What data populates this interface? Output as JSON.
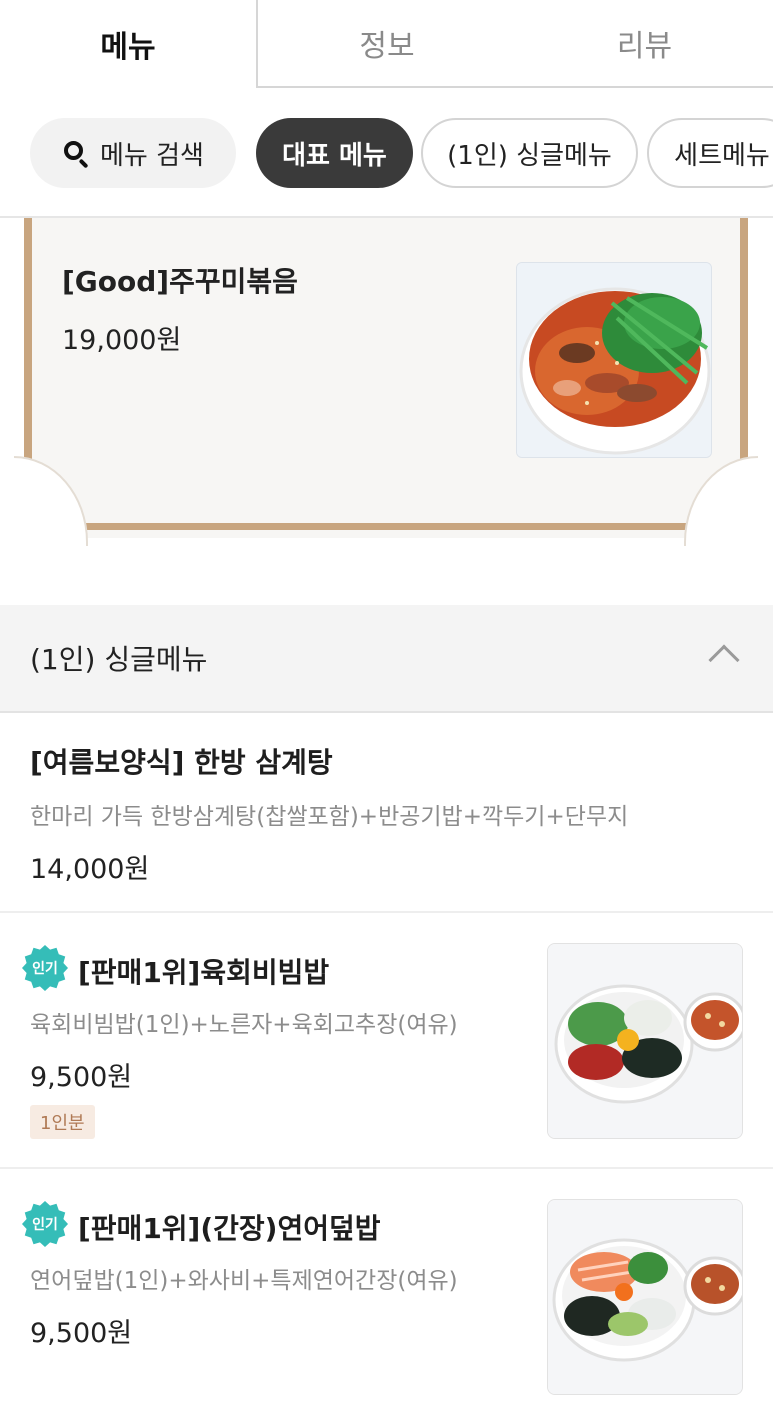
{
  "tabs": [
    {
      "label": "메뉴",
      "active": true
    },
    {
      "label": "정보",
      "active": false
    },
    {
      "label": "리뷰",
      "active": false
    }
  ],
  "chips": {
    "search_label": "메뉴 검색",
    "search_icon": "search-icon",
    "items": [
      {
        "label": "대표 메뉴",
        "active": true
      },
      {
        "label": "(1인) 싱글메뉴",
        "active": false
      },
      {
        "label": "세트메뉴",
        "active": false
      }
    ]
  },
  "featured": {
    "name": "[Good]주꾸미볶음",
    "price": "19,000원"
  },
  "section": {
    "title": "(1인) 싱글메뉴",
    "toggle_icon": "chevron-up-icon"
  },
  "items": [
    {
      "name": "[여름보양식] 한방 삼계탕",
      "desc": "한마리 가득 한방삼계탕(찹쌀포함)+반공기밥+깍두기+단무지",
      "price": "14,000원"
    },
    {
      "badge": "인기",
      "name": "[판매1위]육회비빔밥",
      "desc": "육회비빔밥(1인)+노른자+육회고추장(여유)",
      "price": "9,500원",
      "tag": "1인분"
    },
    {
      "badge": "인기",
      "name": "[판매1위](간장)연어덮밥",
      "desc": "연어덮밥(1인)+와사비+특제연어간장(여유)",
      "price": "9,500원"
    }
  ],
  "colors": {
    "accent_dark": "#3a3a3a",
    "badge_teal": "#35bdb8",
    "frame_tan": "#c8a57f",
    "tag_bg": "#f7ebe2",
    "tag_text": "#b07a55"
  }
}
